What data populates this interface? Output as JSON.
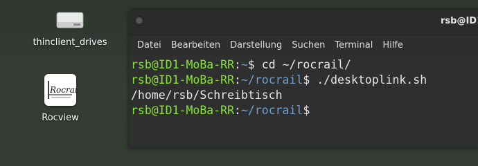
{
  "desktop": {
    "icons": [
      {
        "label": "thinclient_drives",
        "icon": "drive-icon"
      },
      {
        "label": "Rocview",
        "icon": "rocview-app-icon",
        "logo_text": "Rocrail"
      }
    ]
  },
  "terminal": {
    "title": "rsb@ID1-",
    "menu": [
      "Datei",
      "Bearbeiten",
      "Darstellung",
      "Suchen",
      "Terminal",
      "Hilfe"
    ],
    "lines": [
      {
        "user": "rsb@ID1-MoBa-RR",
        "sep": ":",
        "path": "~",
        "prompt": "$",
        "cmd": " cd ~/rocrail/"
      },
      {
        "user": "rsb@ID1-MoBa-RR",
        "sep": ":",
        "path": "~/rocrail",
        "prompt": "$",
        "cmd": " ./desktoplink.sh"
      },
      {
        "output": "/home/rsb/Schreibtisch"
      },
      {
        "user": "rsb@ID1-MoBa-RR",
        "sep": ":",
        "path": "~/rocrail",
        "prompt": "$",
        "cmd": ""
      }
    ],
    "colors": {
      "user": "#8ae234",
      "path": "#729fcf",
      "text": "#e8e8e8",
      "background": "#2f2f2f"
    }
  }
}
